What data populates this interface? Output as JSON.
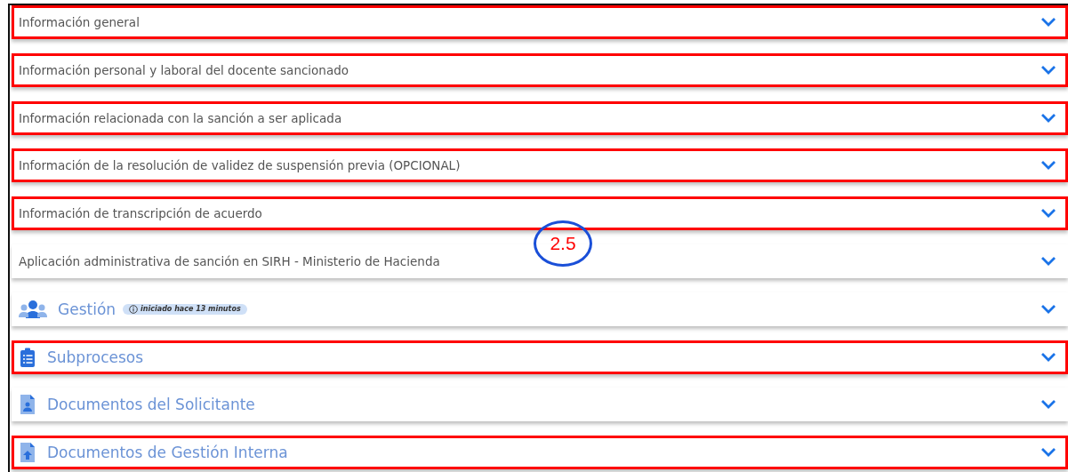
{
  "sections": [
    {
      "kind": "text",
      "title": "Información general",
      "highlighted": true
    },
    {
      "kind": "text",
      "title": "Información personal y laboral del docente sancionado",
      "highlighted": true
    },
    {
      "kind": "text",
      "title": "Información relacionada con la sanción a ser aplicada",
      "highlighted": true
    },
    {
      "kind": "text",
      "title": "Información de la resolución de validez de suspensión previa (OPCIONAL)",
      "highlighted": true
    },
    {
      "kind": "text",
      "title": "Información de transcripción de acuerdo",
      "highlighted": true
    },
    {
      "kind": "text",
      "title": "Aplicación administrativa de sanción en SIRH - Ministerio de Hacienda",
      "highlighted": false
    },
    {
      "kind": "users",
      "title": "Gestión",
      "badge": "iniciado hace 13 minutos",
      "highlighted": false
    },
    {
      "kind": "clipboard",
      "title": "Subprocesos",
      "highlighted": true
    },
    {
      "kind": "person-file",
      "title": "Documentos del Solicitante",
      "highlighted": false
    },
    {
      "kind": "upload-file",
      "title": "Documentos de Gestión Interna",
      "highlighted": true
    }
  ],
  "callout": {
    "label": "2.5"
  }
}
